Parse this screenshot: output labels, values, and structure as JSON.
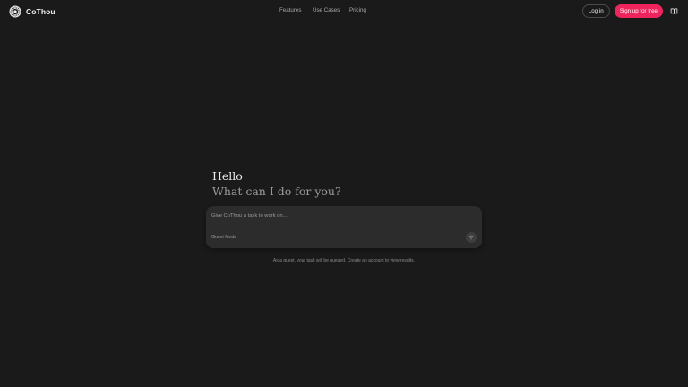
{
  "brand": {
    "name": "CoThou",
    "logo_icon": "sunburst-logo-icon"
  },
  "nav": {
    "features": "Features",
    "use_cases": "Use Cases",
    "pricing": "Pricing"
  },
  "actions": {
    "login": "Log in",
    "signup": "Sign up for free",
    "docs_icon": "book-icon"
  },
  "hero": {
    "greeting": "Hello",
    "subtitle": "What can I do for you?"
  },
  "composer": {
    "placeholder": "Give CoThou a task to work on...",
    "value": "",
    "mode_label": "Guest Mode",
    "send_icon": "arrow-up-icon"
  },
  "note": "As a guest, your task will be queued. Create an account to view results.",
  "colors": {
    "background": "#1a1a1a",
    "accent": "#f0245d",
    "composer_bg": "#2c2c2c"
  }
}
